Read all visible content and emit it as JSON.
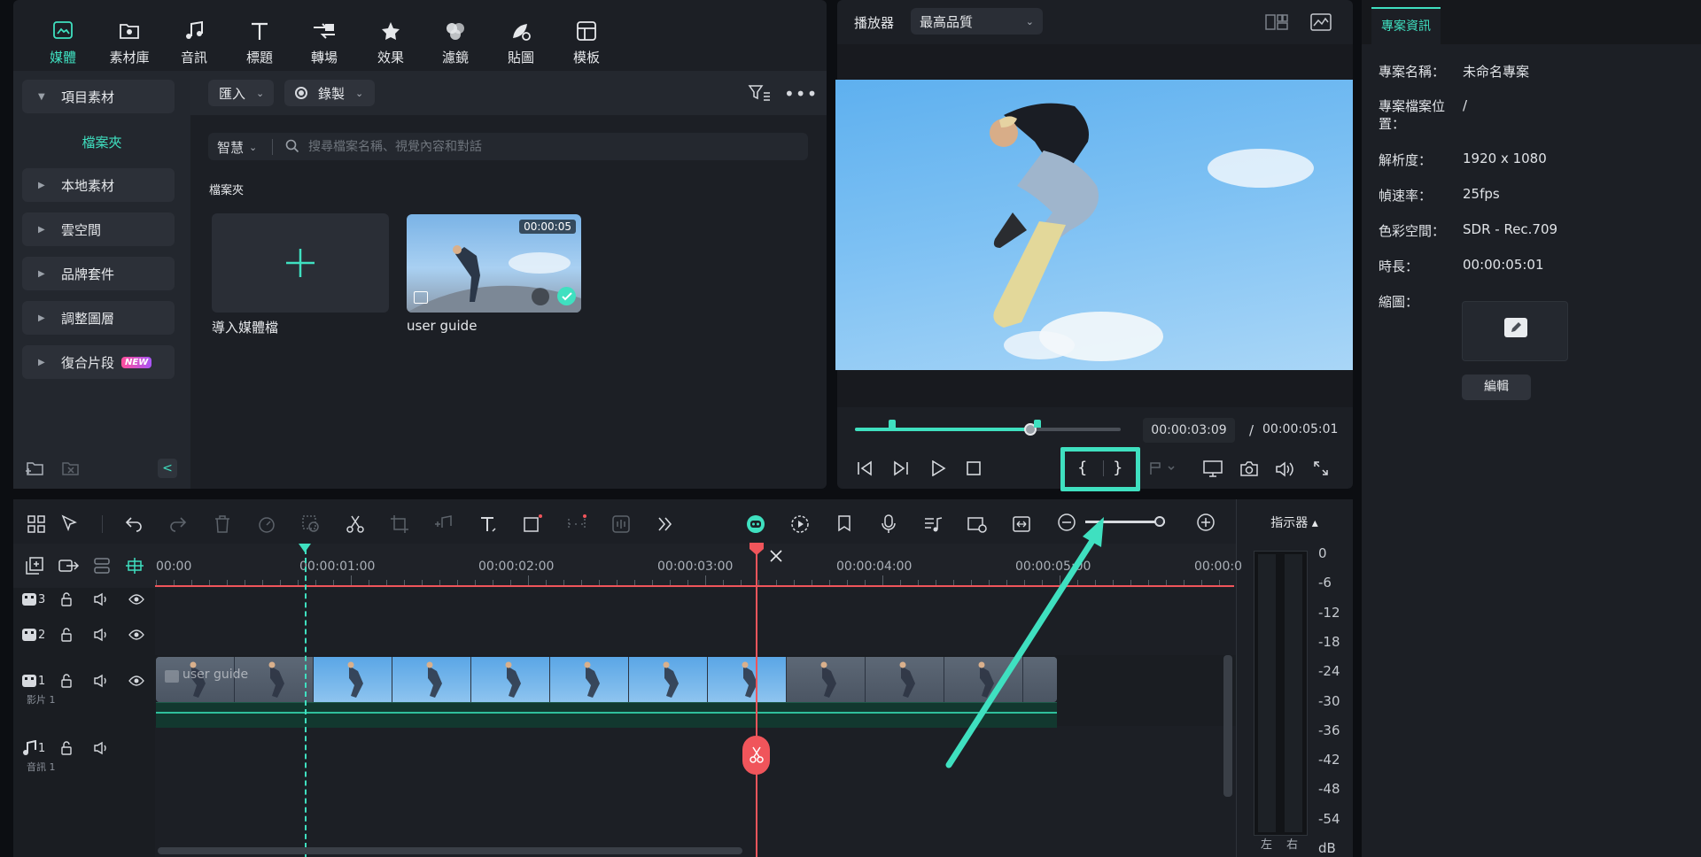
{
  "top_tabs": [
    {
      "label": "媒體",
      "icon": "media-icon",
      "active": true
    },
    {
      "label": "素材庫",
      "icon": "stock-library-icon"
    },
    {
      "label": "音訊",
      "icon": "music-note-icon"
    },
    {
      "label": "標題",
      "icon": "title-t-icon"
    },
    {
      "label": "轉場",
      "icon": "transition-icon"
    },
    {
      "label": "效果",
      "icon": "effects-star-icon"
    },
    {
      "label": "濾鏡",
      "icon": "filter-icon"
    },
    {
      "label": "貼圖",
      "icon": "sticker-icon"
    },
    {
      "label": "模板",
      "icon": "template-icon"
    }
  ],
  "sidebar": {
    "project_media": "項目素材",
    "folder": "檔案夾",
    "items": [
      {
        "label": "本地素材"
      },
      {
        "label": "雲空間"
      },
      {
        "label": "品牌套件"
      },
      {
        "label": "調整圖層"
      },
      {
        "label": "復合片段",
        "badge": "NEW"
      }
    ]
  },
  "media_toolbar": {
    "import": "匯入",
    "record": "錄製",
    "smart": "智慧",
    "search_placeholder": "搜尋檔案名稱、視覺內容和對話"
  },
  "media_area": {
    "section_title": "檔案夾",
    "import_label": "導入媒體檔",
    "clip_name": "user guide",
    "clip_duration": "00:00:05"
  },
  "player": {
    "label": "播放器",
    "quality": "最高品質",
    "current_time": "00:00:03:09",
    "separator": "/",
    "total_time": "00:00:05:01",
    "progress_fraction": 0.66,
    "mark_in": "{",
    "mark_out": "}"
  },
  "project_info": {
    "tab": "專案資訊",
    "rows": [
      {
        "label": "專案名稱：",
        "value": "未命名專案"
      },
      {
        "label": "專案檔案位置：",
        "value": "/"
      },
      {
        "label": "解析度：",
        "value": "1920 x 1080"
      },
      {
        "label": "幀速率：",
        "value": "25fps"
      },
      {
        "label": "色彩空間：",
        "value": "SDR - Rec.709"
      },
      {
        "label": "時長：",
        "value": "00:00:05:01"
      },
      {
        "label": "縮圖：",
        "value": ""
      }
    ],
    "edit_button": "編輯"
  },
  "timeline": {
    "ticks": [
      "00:00",
      "00:00:01:00",
      "00:00:02:00",
      "00:00:03:00",
      "00:00:04:00",
      "00:00:05:00",
      "00:00:0"
    ],
    "clip_label": "user guide",
    "tracks": [
      {
        "num": "3",
        "type": "video"
      },
      {
        "num": "2",
        "type": "video"
      },
      {
        "num": "1",
        "type": "video",
        "name": "影片 1"
      },
      {
        "num": "1",
        "type": "audio",
        "name": "音訊 1"
      }
    ]
  },
  "meter": {
    "label": "指示器 ▴",
    "db_scale": [
      "0",
      "-6",
      "-12",
      "-18",
      "-24",
      "-30",
      "-36",
      "-42",
      "-48",
      "-54",
      "dB"
    ],
    "left": "左",
    "right": "右"
  },
  "colors": {
    "accent": "#3fe0c0",
    "playhead": "#f0555b",
    "background": "#0c0e12",
    "panel": "#1c1f25"
  }
}
